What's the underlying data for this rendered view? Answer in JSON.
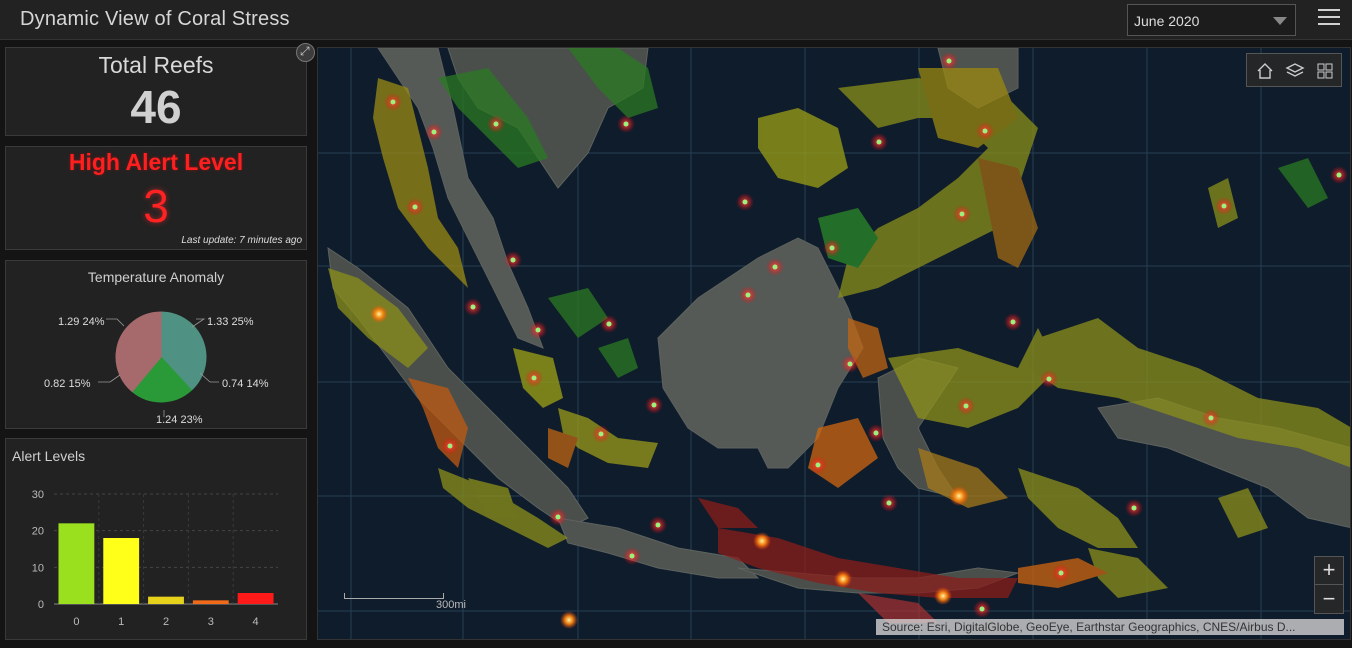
{
  "header": {
    "title": "Dynamic View of Coral Stress",
    "date_selected": "June 2020",
    "menu_icon": "hamburger-menu-icon"
  },
  "total_reefs": {
    "label": "Total Reefs",
    "value": "46"
  },
  "high_alert": {
    "label": "High Alert Level",
    "value": "3",
    "last_update": "Last update: 7 minutes ago",
    "color": "#ff2222"
  },
  "temperature_anomaly": {
    "title": "Temperature Anomaly",
    "labels": [
      "1.33 25%",
      "0.74 14%",
      "1.24 23%",
      "0.82 15%",
      "1.29 24%"
    ]
  },
  "alert_levels": {
    "title": "Alert Levels"
  },
  "chart_data": [
    {
      "type": "pie",
      "title": "Temperature Anomaly",
      "categories": [
        "1.33",
        "0.74",
        "1.24",
        "0.82",
        "1.29"
      ],
      "values": [
        1.33,
        0.74,
        1.24,
        0.82,
        1.29
      ],
      "percent_labels": [
        "25%",
        "14%",
        "23%",
        "15%",
        "24%"
      ],
      "colors": [
        "#4f9283",
        "#4f9283",
        "#2a9a38",
        "#a66a6c",
        "#a66a6c"
      ]
    },
    {
      "type": "bar",
      "title": "Alert Levels",
      "categories": [
        "0",
        "1",
        "2",
        "3",
        "4"
      ],
      "values": [
        22,
        18,
        2,
        1,
        3
      ],
      "colors": [
        "#9be01e",
        "#ffff1a",
        "#e6d21a",
        "#f06a1a",
        "#ff1a1a"
      ],
      "yticks": [
        0,
        10,
        20,
        30
      ],
      "ylim": [
        0,
        30
      ],
      "grid": true
    }
  ],
  "map": {
    "scale_label": "300mi",
    "attribution": "Source: Esri, DigitalGlobe, GeoEye, Earthstar Geographics, CNES/Airbus D...",
    "zoom_in_label": "+",
    "zoom_out_label": "−",
    "tools": [
      "home-icon",
      "layers-icon",
      "basemap-gallery-icon"
    ]
  }
}
